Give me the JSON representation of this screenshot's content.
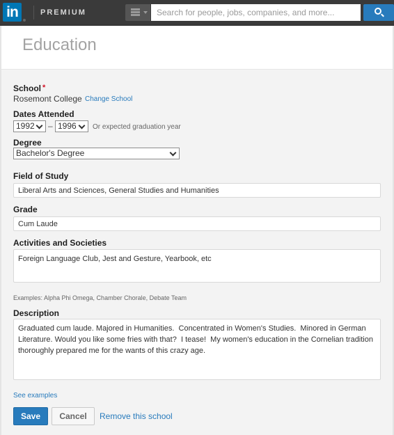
{
  "topbar": {
    "logo_text": "in",
    "premium_label": "PREMIUM",
    "search_placeholder": "Search for people, jobs, companies, and more...",
    "icons": {
      "menu": "hamburger-icon",
      "search": "search-icon"
    },
    "colors": {
      "bar": "#3a3a3a",
      "brand": "#0077b5",
      "search_button": "#287bbc"
    }
  },
  "page": {
    "title": "Education"
  },
  "form": {
    "school": {
      "label": "School",
      "required_mark": "*",
      "value": "Rosemont College",
      "change_link": "Change School"
    },
    "dates": {
      "label": "Dates Attended",
      "start_year": "1992",
      "separator": "–",
      "end_year": "1996",
      "hint": "Or expected graduation year"
    },
    "degree": {
      "label": "Degree",
      "value": "Bachelor's Degree"
    },
    "field_of_study": {
      "label": "Field of Study",
      "value": "Liberal Arts and Sciences, General Studies and Humanities"
    },
    "grade": {
      "label": "Grade",
      "value": "Cum Laude"
    },
    "activities": {
      "label": "Activities and Societies",
      "value": "Foreign Language Club, Jest and Gesture, Yearbook, etc",
      "examples": "Examples: Alpha Phi Omega, Chamber Chorale, Debate Team"
    },
    "description": {
      "label": "Description",
      "value": "Graduated cum laude. Majored in Humanities.  Concentrated in Women's Studies.  Minored in German Literature. Would you like some fries with that?  I tease!  My women's education in the Cornelian tradition thoroughly prepared me for the wants of this crazy age.",
      "see_examples": "See examples"
    },
    "actions": {
      "save": "Save",
      "cancel": "Cancel",
      "remove": "Remove this school"
    }
  }
}
